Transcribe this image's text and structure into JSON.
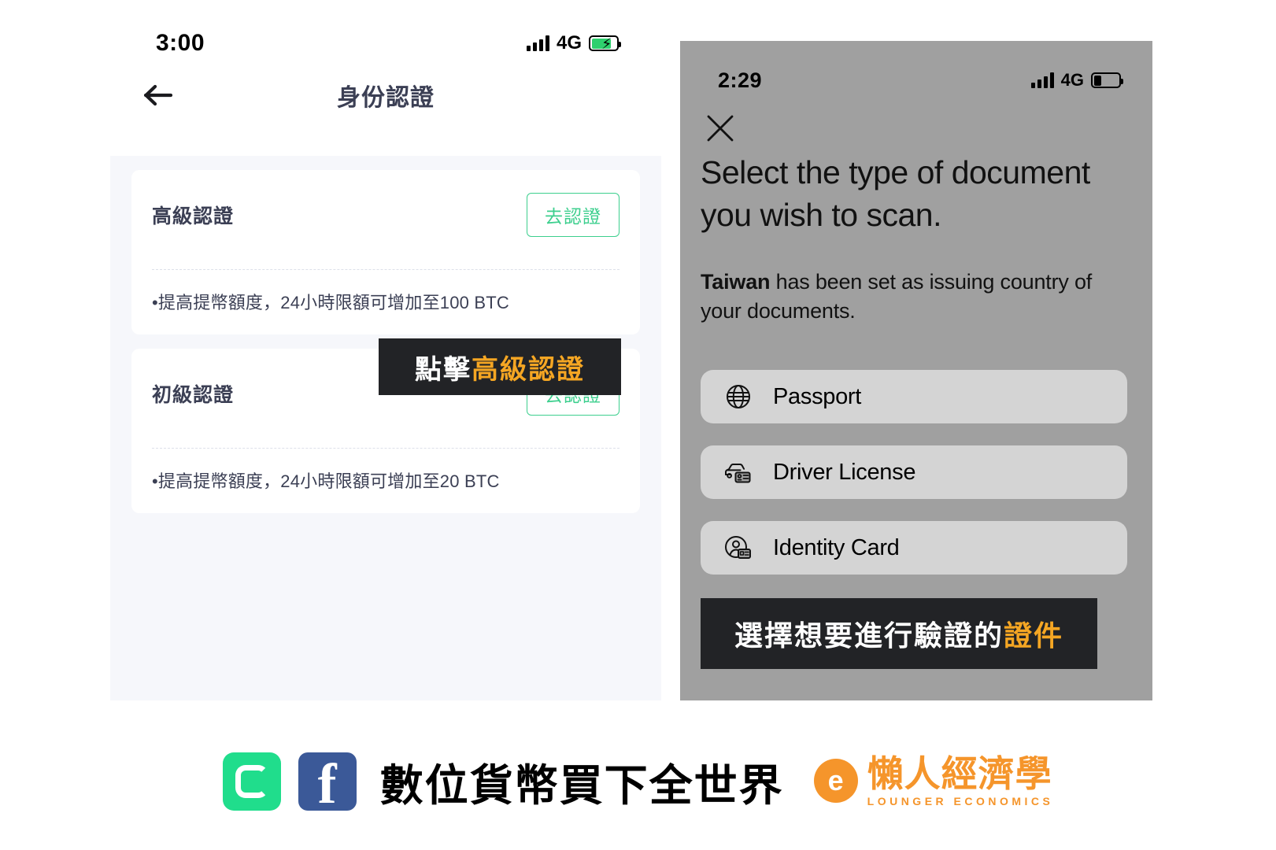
{
  "left_phone": {
    "status_bar": {
      "time": "3:00",
      "network": "4G",
      "signal_icon": "cellular-bars-icon",
      "battery_icon": "battery-charging-icon"
    },
    "nav": {
      "back_icon": "back-arrow-icon",
      "title": "身份認證"
    },
    "cards": [
      {
        "title": "高級認證",
        "button_label": "去認證",
        "description": "•提高提幣額度，24小時限額可增加至100 BTC"
      },
      {
        "title": "初級認證",
        "button_label": "去認證",
        "description": "•提高提幣額度，24小時限額可增加至20 BTC"
      }
    ]
  },
  "right_phone": {
    "status_bar": {
      "time": "2:29",
      "network": "4G",
      "signal_icon": "cellular-bars-icon",
      "battery_icon": "battery-low-icon"
    },
    "close_icon": "close-x-icon",
    "heading": "Select the type of document you wish to scan.",
    "sub_bold": "Taiwan",
    "sub_rest": " has been set as issuing country of your documents.",
    "documents": [
      {
        "label": "Passport",
        "icon": "globe-icon"
      },
      {
        "label": "Driver License",
        "icon": "car-license-icon"
      },
      {
        "label": "Identity Card",
        "icon": "identity-card-icon"
      }
    ]
  },
  "captions": {
    "left": {
      "plain": "點擊",
      "highlight": "高級認證"
    },
    "right": {
      "plain": "選擇想要進行驗證的",
      "highlight": "證件"
    }
  },
  "brand_bar": {
    "app_icon": "app-logo-icon",
    "facebook_icon": "facebook-icon",
    "facebook_glyph": "f",
    "title": "數位貨幣買下全世界",
    "lounger_mark_glyph": "e",
    "lounger_cn": "懶人經濟學",
    "lounger_en": "LOUNGER ECONOMICS"
  },
  "colors": {
    "accent_green": "#3dcf8e",
    "caption_bg": "#222326",
    "caption_highlight": "#f5a623",
    "brand_orange": "#f5952b",
    "facebook_blue": "#3b5998",
    "app_green": "#20dd8c"
  }
}
